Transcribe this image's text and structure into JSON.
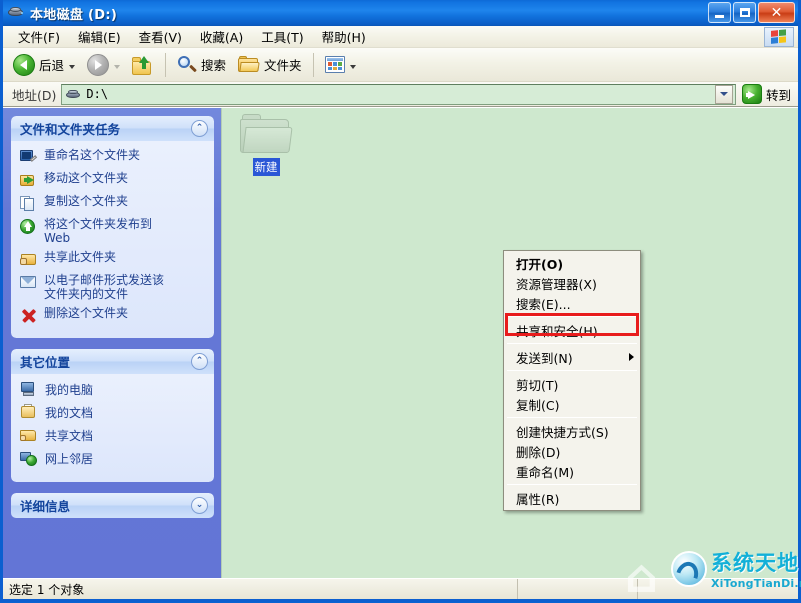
{
  "window": {
    "title": "本地磁盘 (D:)",
    "title_icon": "hard-drive-icon",
    "controls": {
      "minimize": "_",
      "maximize": "□",
      "close": "✕"
    }
  },
  "menubar": {
    "items": [
      {
        "label": "文件(F)"
      },
      {
        "label": "编辑(E)"
      },
      {
        "label": "查看(V)"
      },
      {
        "label": "收藏(A)"
      },
      {
        "label": "工具(T)"
      },
      {
        "label": "帮助(H)"
      }
    ],
    "flag_icon": "windows-flag-icon"
  },
  "toolbar": {
    "back_label": "后退",
    "forward_label": "",
    "up_label": "",
    "search_label": "搜索",
    "folders_label": "文件夹",
    "views_label": ""
  },
  "address": {
    "label": "地址(D)",
    "value": "D:\\",
    "go_label": "转到"
  },
  "sidebar": {
    "panels": [
      {
        "title": "文件和文件夹任务",
        "collapse_glyph": "⌃",
        "expanded": true,
        "items": [
          {
            "label": "重命名这个文件夹",
            "icon": "rename-icon"
          },
          {
            "label": "移动这个文件夹",
            "icon": "move-icon"
          },
          {
            "label": "复制这个文件夹",
            "icon": "copy-icon"
          },
          {
            "label": "将这个文件夹发布到\nWeb",
            "icon": "publish-web-icon"
          },
          {
            "label": "共享此文件夹",
            "icon": "share-folder-icon"
          },
          {
            "label": "以电子邮件形式发送该\n文件夹内的文件",
            "icon": "email-icon"
          },
          {
            "label": "删除这个文件夹",
            "icon": "delete-icon"
          }
        ]
      },
      {
        "title": "其它位置",
        "collapse_glyph": "⌃",
        "expanded": true,
        "items": [
          {
            "label": "我的电脑",
            "icon": "my-computer-icon"
          },
          {
            "label": "我的文档",
            "icon": "my-documents-icon"
          },
          {
            "label": "共享文档",
            "icon": "shared-documents-icon"
          },
          {
            "label": "网上邻居",
            "icon": "network-places-icon"
          }
        ]
      },
      {
        "title": "详细信息",
        "collapse_glyph": "⌄",
        "expanded": false,
        "items": []
      }
    ]
  },
  "content": {
    "file_item": {
      "name": "新建",
      "icon": "folder-icon",
      "selected": true
    }
  },
  "context_menu": {
    "items": [
      {
        "label": "打开(O)",
        "bold": true,
        "type": "item"
      },
      {
        "label": "资源管理器(X)",
        "bold": false,
        "type": "item"
      },
      {
        "label": "搜索(E)...",
        "bold": false,
        "type": "item"
      },
      {
        "type": "separator"
      },
      {
        "label": "共享和安全(H)...",
        "bold": false,
        "type": "item",
        "highlighted": true
      },
      {
        "type": "separator"
      },
      {
        "label": "发送到(N)",
        "bold": false,
        "type": "submenu"
      },
      {
        "type": "separator"
      },
      {
        "label": "剪切(T)",
        "bold": false,
        "type": "item"
      },
      {
        "label": "复制(C)",
        "bold": false,
        "type": "item"
      },
      {
        "type": "separator"
      },
      {
        "label": "创建快捷方式(S)",
        "bold": false,
        "type": "item"
      },
      {
        "label": "删除(D)",
        "bold": false,
        "type": "item"
      },
      {
        "label": "重命名(M)",
        "bold": false,
        "type": "item"
      },
      {
        "type": "separator"
      },
      {
        "label": "属性(R)",
        "bold": false,
        "type": "item"
      }
    ]
  },
  "statusbar": {
    "text": "选定 1 个对象"
  },
  "watermark": {
    "title": "系统天地",
    "url": "XiTongTianDi.net"
  },
  "colors": {
    "titlebar_blue": "#1173e0",
    "sidebar_blue": "#6375d6",
    "content_green": "#cee8ce",
    "highlight_red": "#e81c1c",
    "panel_title": "#13449c",
    "watermark_cyan": "#12b0d8"
  }
}
